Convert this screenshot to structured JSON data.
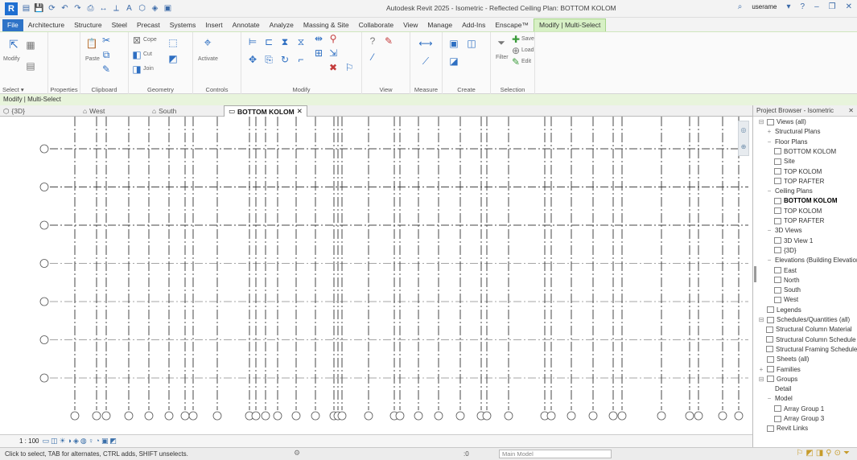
{
  "titlebar": {
    "title": "Autodesk Revit 2025 - Isometric - Reflected Ceiling Plan: BOTTOM KOLOM",
    "logo_letter": "R",
    "qat_icons": [
      "open-icon",
      "save-icon",
      "sync-icon",
      "undo-icon",
      "redo-icon",
      "print-icon",
      "measure-icon",
      "dimension-icon",
      "text-icon",
      "3d-icon",
      "section-icon",
      "close-views-icon"
    ],
    "user_label": "userame",
    "window_controls": [
      "minimize-icon",
      "maximize-icon",
      "close-icon"
    ]
  },
  "tabs": [
    "File",
    "Architecture",
    "Structure",
    "Steel",
    "Precast",
    "Systems",
    "Insert",
    "Annotate",
    "Analyze",
    "Massing & Site",
    "Collaborate",
    "View",
    "Manage",
    "Add-Ins",
    "Enscape™",
    "Modify | Multi-Select"
  ],
  "active_tab": "Modify | Multi-Select",
  "ribbon": {
    "groups": [
      {
        "label": "Select ▾"
      },
      {
        "label": "Properties"
      },
      {
        "label": "Clipboard"
      },
      {
        "label": "Geometry"
      },
      {
        "label": "Controls"
      },
      {
        "label": "Modify"
      },
      {
        "label": "View"
      },
      {
        "label": "Measure"
      },
      {
        "label": "Create"
      },
      {
        "label": "Selection"
      }
    ],
    "modify_label": "Modify",
    "paste_label": "Paste",
    "cope_label": "Cope",
    "cut_label": "Cut",
    "join_label": "Join",
    "activate_label": "Activate",
    "filter_label": "Filter",
    "save_label": "Save",
    "load_label": "Load",
    "edit_label": "Edit"
  },
  "modify_strip": "Modify | Multi-Select",
  "view_tabs": [
    {
      "label": "{3D}"
    },
    {
      "label": "West"
    },
    {
      "label": "South"
    },
    {
      "label": "BOTTOM KOLOM",
      "active": true
    }
  ],
  "canvas": {
    "grid_rows": 7,
    "grid_cols": 38
  },
  "view_control": {
    "scale": "1 : 100"
  },
  "statusbar": {
    "text": "Click to select, TAB for alternates, CTRL adds, SHIFT unselects.",
    "zero": ":0",
    "model": "Main Model"
  },
  "browser": {
    "title": "Project Browser - Isometric",
    "items": [
      {
        "level": 0,
        "exp": "⊟",
        "label": "Views (all)",
        "icon": "views-icon"
      },
      {
        "level": 1,
        "exp": "+",
        "label": "Structural Plans"
      },
      {
        "level": 1,
        "exp": "−",
        "label": "Floor Plans"
      },
      {
        "level": 2,
        "label": "BOTTOM KOLOM",
        "icon": "plan-icon"
      },
      {
        "level": 2,
        "label": "Site",
        "icon": "plan-icon"
      },
      {
        "level": 2,
        "label": "TOP KOLOM",
        "icon": "plan-icon"
      },
      {
        "level": 2,
        "label": "TOP RAFTER",
        "icon": "plan-icon"
      },
      {
        "level": 1,
        "exp": "−",
        "label": "Ceiling Plans"
      },
      {
        "level": 2,
        "label": "BOTTOM KOLOM",
        "icon": "plan-icon",
        "bold": true
      },
      {
        "level": 2,
        "label": "TOP KOLOM",
        "icon": "plan-icon"
      },
      {
        "level": 2,
        "label": "TOP RAFTER",
        "icon": "plan-icon"
      },
      {
        "level": 1,
        "exp": "−",
        "label": "3D Views"
      },
      {
        "level": 2,
        "label": "3D View 1",
        "icon": "plan-icon"
      },
      {
        "level": 2,
        "label": "{3D}",
        "icon": "plan-icon"
      },
      {
        "level": 1,
        "exp": "−",
        "label": "Elevations (Building Elevation)"
      },
      {
        "level": 2,
        "label": "East",
        "icon": "plan-icon"
      },
      {
        "level": 2,
        "label": "North",
        "icon": "plan-icon"
      },
      {
        "level": 2,
        "label": "South",
        "icon": "plan-icon"
      },
      {
        "level": 2,
        "label": "West",
        "icon": "plan-icon"
      },
      {
        "level": 0,
        "exp": "",
        "label": "Legends",
        "icon": "legend-icon"
      },
      {
        "level": 0,
        "exp": "⊟",
        "label": "Schedules/Quantities (all)",
        "icon": "schedule-icon"
      },
      {
        "level": 1,
        "label": "Structural Column Material",
        "icon": "plan-icon"
      },
      {
        "level": 1,
        "label": "Structural Column Schedule",
        "icon": "plan-icon"
      },
      {
        "level": 1,
        "label": "Structural Framing Schedule",
        "icon": "plan-icon"
      },
      {
        "level": 0,
        "exp": "",
        "label": "Sheets (all)",
        "icon": "sheet-icon"
      },
      {
        "level": 0,
        "exp": "+",
        "label": "Families",
        "icon": "family-icon"
      },
      {
        "level": 0,
        "exp": "⊟",
        "label": "Groups",
        "icon": "group-icon"
      },
      {
        "level": 1,
        "exp": "",
        "label": "Detail"
      },
      {
        "level": 1,
        "exp": "−",
        "label": "Model"
      },
      {
        "level": 2,
        "label": "Array Group 1",
        "icon": "group-icon"
      },
      {
        "level": 2,
        "label": "Array Group 3",
        "icon": "group-icon"
      },
      {
        "level": 0,
        "exp": "",
        "label": "Revit Links",
        "icon": "link-icon"
      }
    ]
  }
}
